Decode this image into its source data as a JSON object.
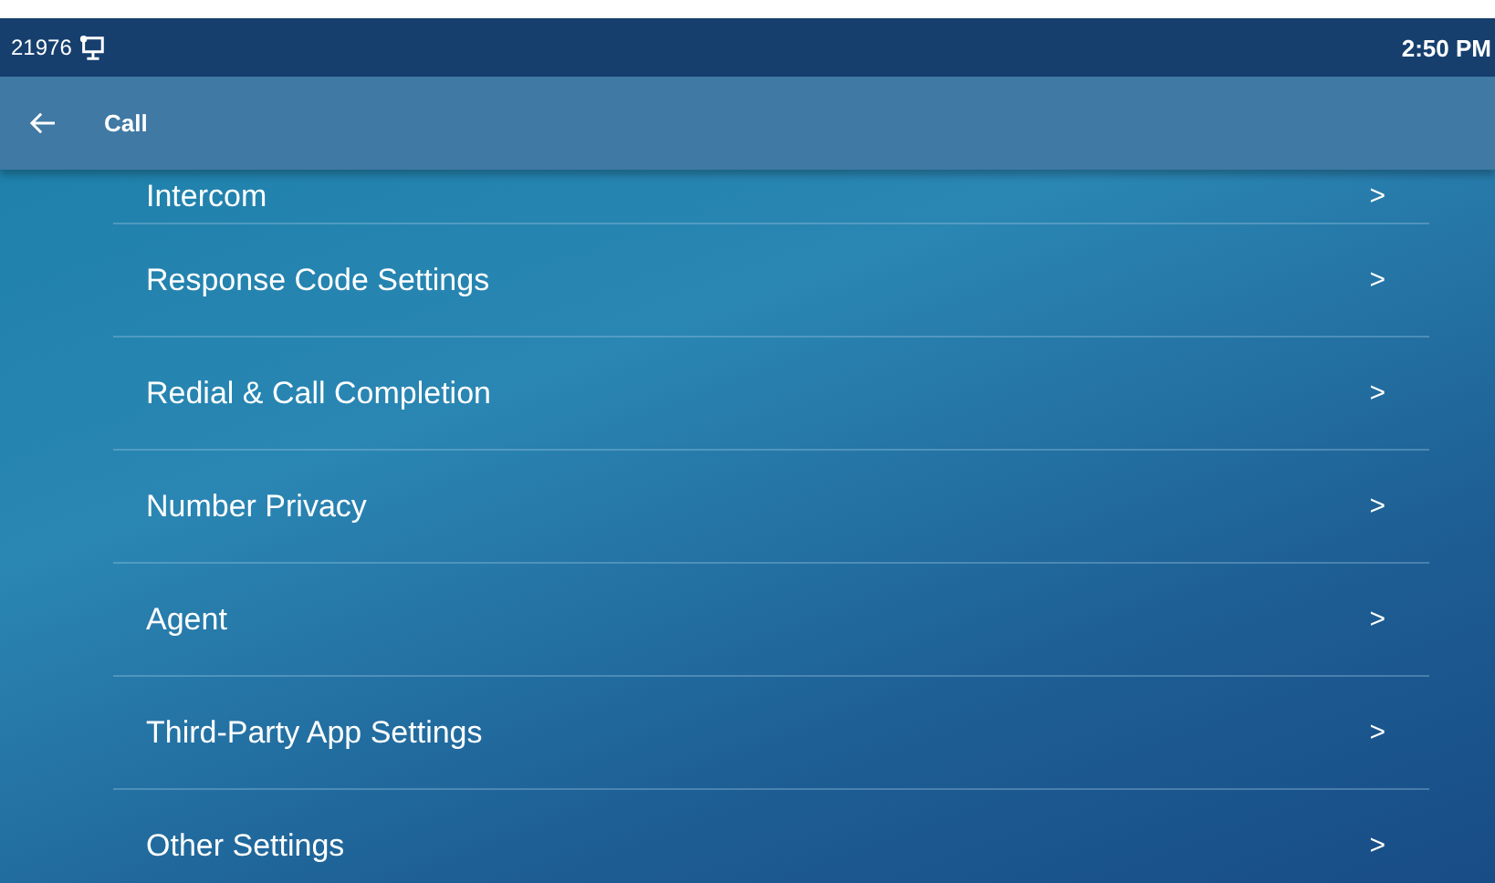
{
  "status_bar": {
    "extension": "21976",
    "time": "2:50 PM"
  },
  "header": {
    "title": "Call"
  },
  "items": [
    {
      "label": "Intercom",
      "arrow": ">"
    },
    {
      "label": "Response Code Settings",
      "arrow": ">"
    },
    {
      "label": "Redial & Call Completion",
      "arrow": ">"
    },
    {
      "label": "Number Privacy",
      "arrow": ">"
    },
    {
      "label": "Agent",
      "arrow": ">"
    },
    {
      "label": "Third-Party App Settings",
      "arrow": ">"
    },
    {
      "label": "Other Settings",
      "arrow": ">"
    }
  ]
}
